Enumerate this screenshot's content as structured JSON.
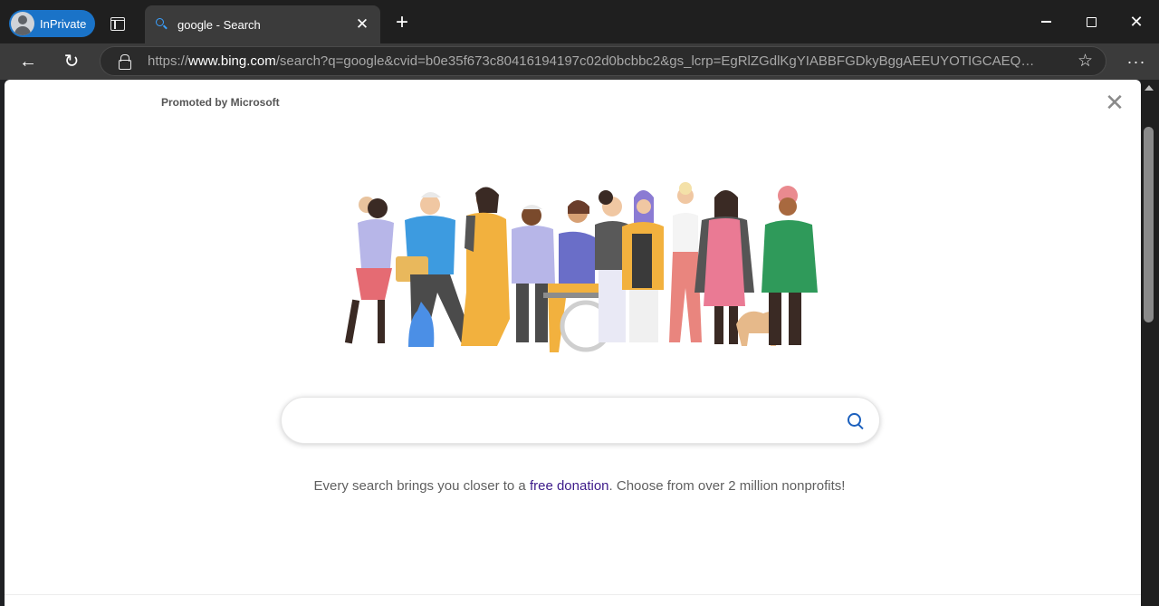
{
  "browser": {
    "mode_label": "InPrivate",
    "tab": {
      "title": "google - Search",
      "favicon": "search-icon"
    },
    "url": {
      "scheme": "https://",
      "host": "www.bing.com",
      "rest": "/search?q=google&cvid=b0e35f673c80416194197c02d0bcbbc2&gs_lcrp=EgRlZGdlKgYIABBFGDkyBggAEEUYOTIGCAEQRRg8..."
    },
    "icons": {
      "back": "back-arrow-icon",
      "reload": "reload-icon",
      "lock": "lock-icon",
      "favorite": "star-icon",
      "more": "more-icon",
      "new_tab": "plus-icon",
      "tab_actions": "tab-actions-icon"
    },
    "window_controls": {
      "minimize": "minimize",
      "maximize": "maximize",
      "close": "close"
    }
  },
  "promo": {
    "label": "Promoted by Microsoft",
    "search_placeholder": "",
    "tagline_before": "Every search brings you closer to a ",
    "tagline_link": "free donation",
    "tagline_after": ". Choose from over 2 million nonprofits!"
  },
  "colors": {
    "inprivate_badge": "#1a73c8",
    "link": "#3d1b8a",
    "search_icon": "#1a5fbd"
  }
}
